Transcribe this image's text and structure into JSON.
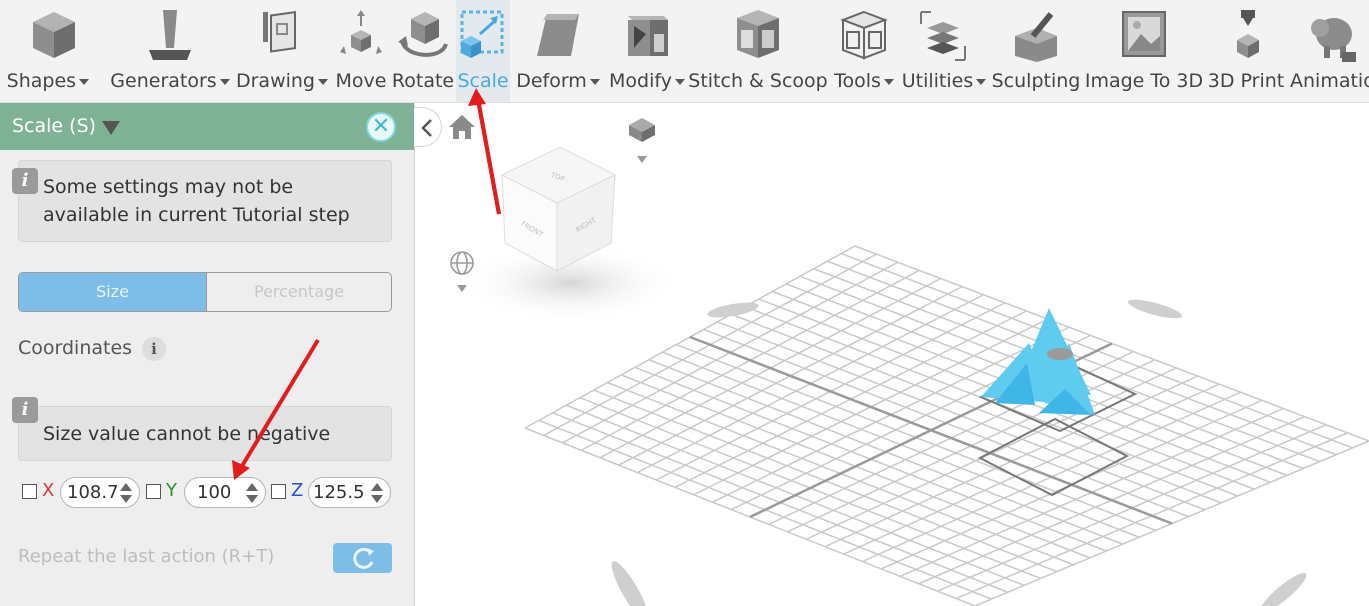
{
  "toolbar": {
    "items": [
      {
        "label": "D Shapes",
        "icon": "cube-icon",
        "dropdown": true
      },
      {
        "label": "Generators",
        "icon": "generator-icon",
        "dropdown": true
      },
      {
        "label": "Drawing",
        "icon": "drawing-icon",
        "dropdown": true
      },
      {
        "label": "Move",
        "icon": "move-icon",
        "dropdown": false
      },
      {
        "label": "Rotate",
        "icon": "rotate-icon",
        "dropdown": false
      },
      {
        "label": "Scale",
        "icon": "scale-icon",
        "dropdown": false,
        "active": true
      },
      {
        "label": "Deform",
        "icon": "deform-icon",
        "dropdown": true
      },
      {
        "label": "Modify",
        "icon": "modify-icon",
        "dropdown": true
      },
      {
        "label": "Stitch & Scoop",
        "icon": "stitch-scoop-icon",
        "dropdown": false
      },
      {
        "label": "Tools",
        "icon": "tools-icon",
        "dropdown": true
      },
      {
        "label": "Utilities",
        "icon": "utilities-icon",
        "dropdown": true
      },
      {
        "label": "Sculpting",
        "icon": "sculpting-icon",
        "dropdown": false
      },
      {
        "label": "Image To 3D",
        "icon": "image-to-3d-icon",
        "dropdown": false
      },
      {
        "label": "3D Print",
        "icon": "3d-print-icon",
        "dropdown": false
      },
      {
        "label": "Animatio",
        "icon": "animation-icon",
        "dropdown": false
      }
    ]
  },
  "panel": {
    "title": "Scale (S)",
    "tutorial_notice": "Some settings may not be available in current Tutorial step",
    "tabs": {
      "size": "Size",
      "percentage": "Percentage",
      "selected": "Size"
    },
    "coordinates_label": "Coordinates",
    "info_icon": "i",
    "warning": "Size value cannot be negative",
    "axes": [
      {
        "label": "X",
        "value": "108.7",
        "color": "#d23a3a"
      },
      {
        "label": "Y",
        "value": "100",
        "color": "#2e8b2e"
      },
      {
        "label": "Z",
        "value": "125.5",
        "color": "#2a4fd6"
      }
    ],
    "repeat_label": "Repeat the last action (R+T)"
  },
  "viewport": {
    "view_cube": {
      "top": "TOP",
      "front": "FRONT",
      "right": "RIGHT"
    },
    "model_color": "#5fcbee"
  }
}
